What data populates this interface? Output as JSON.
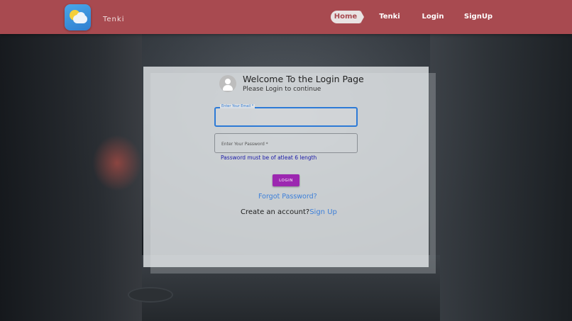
{
  "navbar": {
    "brand": "Tenki",
    "logo_icon": "weather-sun-cloud-icon",
    "items": [
      {
        "label": "Home",
        "active": true
      },
      {
        "label": "Tenki"
      },
      {
        "label": "Login"
      },
      {
        "label": "SignUp"
      }
    ],
    "background_color": "#a84a50"
  },
  "login": {
    "avatar_icon": "user-avatar-icon",
    "title": "Welcome To the Login Page",
    "subtitle": "Please Login to continue",
    "email": {
      "label": "Enter Your Email *",
      "value": ""
    },
    "password": {
      "placeholder": "Enter Your Password *",
      "value": ""
    },
    "error_text": "Password must be of atleat 6 length",
    "login_button": "LOGIN",
    "forgot_link": "Forgot Password?",
    "create_account_text": "Create an account?",
    "signup_link": "Sign Up",
    "accent_color": "#9c27b0",
    "link_color": "#3d7fd9"
  }
}
